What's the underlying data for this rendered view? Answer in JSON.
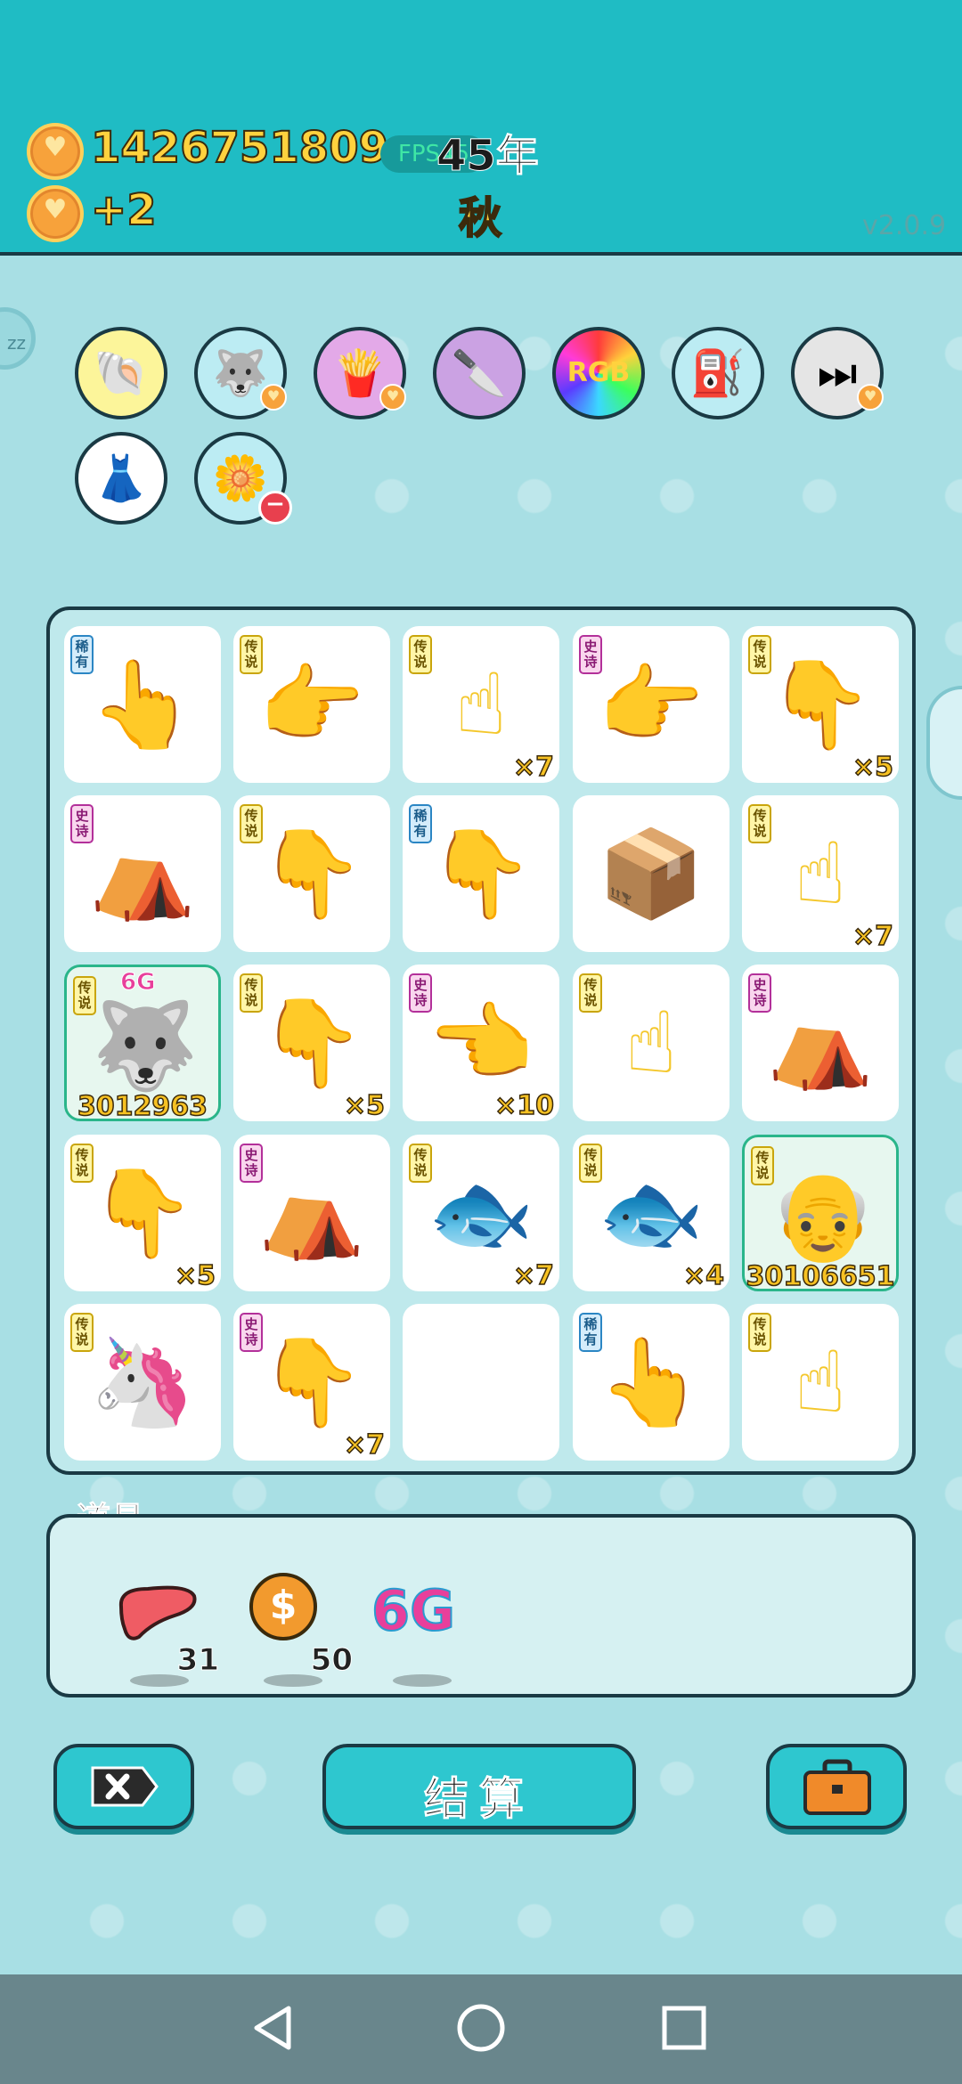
{
  "header": {
    "coins": "1426751809",
    "income": "+2",
    "fps": "FPS45",
    "year": "45年",
    "season": "秋",
    "version": "v2.0.9"
  },
  "side": {
    "zz_label": "zz"
  },
  "buffs": [
    {
      "icon": "shell-icon",
      "glyph": "🐚",
      "bg": "#fcf59a"
    },
    {
      "icon": "husky-icon",
      "glyph": "🐺",
      "bg": "#bcecf3"
    },
    {
      "icon": "fries-icon",
      "glyph": "🍟",
      "bg": "#e3a9e8"
    },
    {
      "icon": "cleaver-icon",
      "glyph": "🔪",
      "bg": "#cba2e3"
    },
    {
      "icon": "rgb-icon",
      "glyph": "RGB",
      "bg": "#222222"
    },
    {
      "icon": "pump-icon",
      "glyph": "⛽",
      "bg": "#bcecf3"
    },
    {
      "icon": "skip-icon",
      "glyph": "⏭",
      "bg": "#e5e5e5"
    },
    {
      "icon": "skirt-icon",
      "glyph": "👗",
      "bg": "#ffffff"
    },
    {
      "icon": "flower-pot-icon",
      "glyph": "🌼",
      "bg": "#bcecf3"
    }
  ],
  "board": {
    "cells": [
      {
        "tag": "稀有",
        "rarity": "rare",
        "glyph": "👆",
        "color": "#6b3a1f",
        "count": ""
      },
      {
        "tag": "传说",
        "rarity": "legend",
        "glyph": "👉",
        "color": "#f4c72b",
        "count": ""
      },
      {
        "tag": "传说",
        "rarity": "legend",
        "glyph": "☝",
        "color": "#f4c72b",
        "count": "×7"
      },
      {
        "tag": "史诗",
        "rarity": "epic",
        "glyph": "👉",
        "color": "#9a9a9a",
        "count": ""
      },
      {
        "tag": "传说",
        "rarity": "legend",
        "glyph": "👇",
        "color": "#f4c72b",
        "count": "×5"
      },
      {
        "tag": "史诗",
        "rarity": "epic",
        "glyph": "⛺",
        "color": "#c98aa8",
        "count": ""
      },
      {
        "tag": "传说",
        "rarity": "legend",
        "glyph": "👇",
        "color": "#f4c72b",
        "count": ""
      },
      {
        "tag": "稀有",
        "rarity": "rare",
        "glyph": "👇",
        "color": "#6b3a1f",
        "count": ""
      },
      {
        "tag": "",
        "rarity": "",
        "glyph": "📦",
        "color": "#d9a86c",
        "count": ""
      },
      {
        "tag": "传说",
        "rarity": "legend",
        "glyph": "☝",
        "color": "#f4c72b",
        "count": "×7"
      },
      {
        "tag": "传说",
        "rarity": "legend",
        "glyph": "🐺",
        "color": "#555555",
        "count": "",
        "score": "3012963",
        "gtag": "6G",
        "highlight": true
      },
      {
        "tag": "传说",
        "rarity": "legend",
        "glyph": "👇",
        "color": "#f4c72b",
        "count": "×5"
      },
      {
        "tag": "史诗",
        "rarity": "epic",
        "glyph": "👈",
        "color": "#9a9a9a",
        "count": "×10"
      },
      {
        "tag": "传说",
        "rarity": "legend",
        "glyph": "☝",
        "color": "#f4c72b",
        "count": ""
      },
      {
        "tag": "史诗",
        "rarity": "epic",
        "glyph": "⛺",
        "color": "#c98aa8",
        "count": ""
      },
      {
        "tag": "传说",
        "rarity": "legend",
        "glyph": "👇",
        "color": "#f4c72b",
        "count": "×5"
      },
      {
        "tag": "史诗",
        "rarity": "epic",
        "glyph": "⛺",
        "color": "#c98aa8",
        "count": ""
      },
      {
        "tag": "传说",
        "rarity": "legend",
        "glyph": "🐟",
        "color": "#e84a4a",
        "count": "×7"
      },
      {
        "tag": "传说",
        "rarity": "legend",
        "glyph": "🐟",
        "color": "#e84a4a",
        "count": "×4"
      },
      {
        "tag": "传说",
        "rarity": "legend",
        "glyph": "👴",
        "color": "#f4c72b",
        "count": "",
        "score": "30106651",
        "highlight": true
      },
      {
        "tag": "传说",
        "rarity": "legend",
        "glyph": "🦄",
        "color": "#f28dc0",
        "count": ""
      },
      {
        "tag": "史诗",
        "rarity": "epic",
        "glyph": "👇",
        "color": "#9a9a9a",
        "count": "×7"
      },
      {
        "tag": "",
        "rarity": "",
        "glyph": "",
        "color": "#000000",
        "count": ""
      },
      {
        "tag": "稀有",
        "rarity": "rare",
        "glyph": "👆",
        "color": "#6b3a1f",
        "count": ""
      },
      {
        "tag": "传说",
        "rarity": "legend",
        "glyph": "☝",
        "color": "#f4c72b",
        "count": ""
      }
    ]
  },
  "items": {
    "label": "道具",
    "list": [
      {
        "icon": "liver-icon",
        "glyph": "🫁",
        "count": "31"
      },
      {
        "icon": "dollar-coin-icon",
        "glyph": "$",
        "count": "50"
      },
      {
        "icon": "6g-icon",
        "glyph": "6G",
        "count": ""
      }
    ]
  },
  "buttons": {
    "settle": "结算"
  }
}
